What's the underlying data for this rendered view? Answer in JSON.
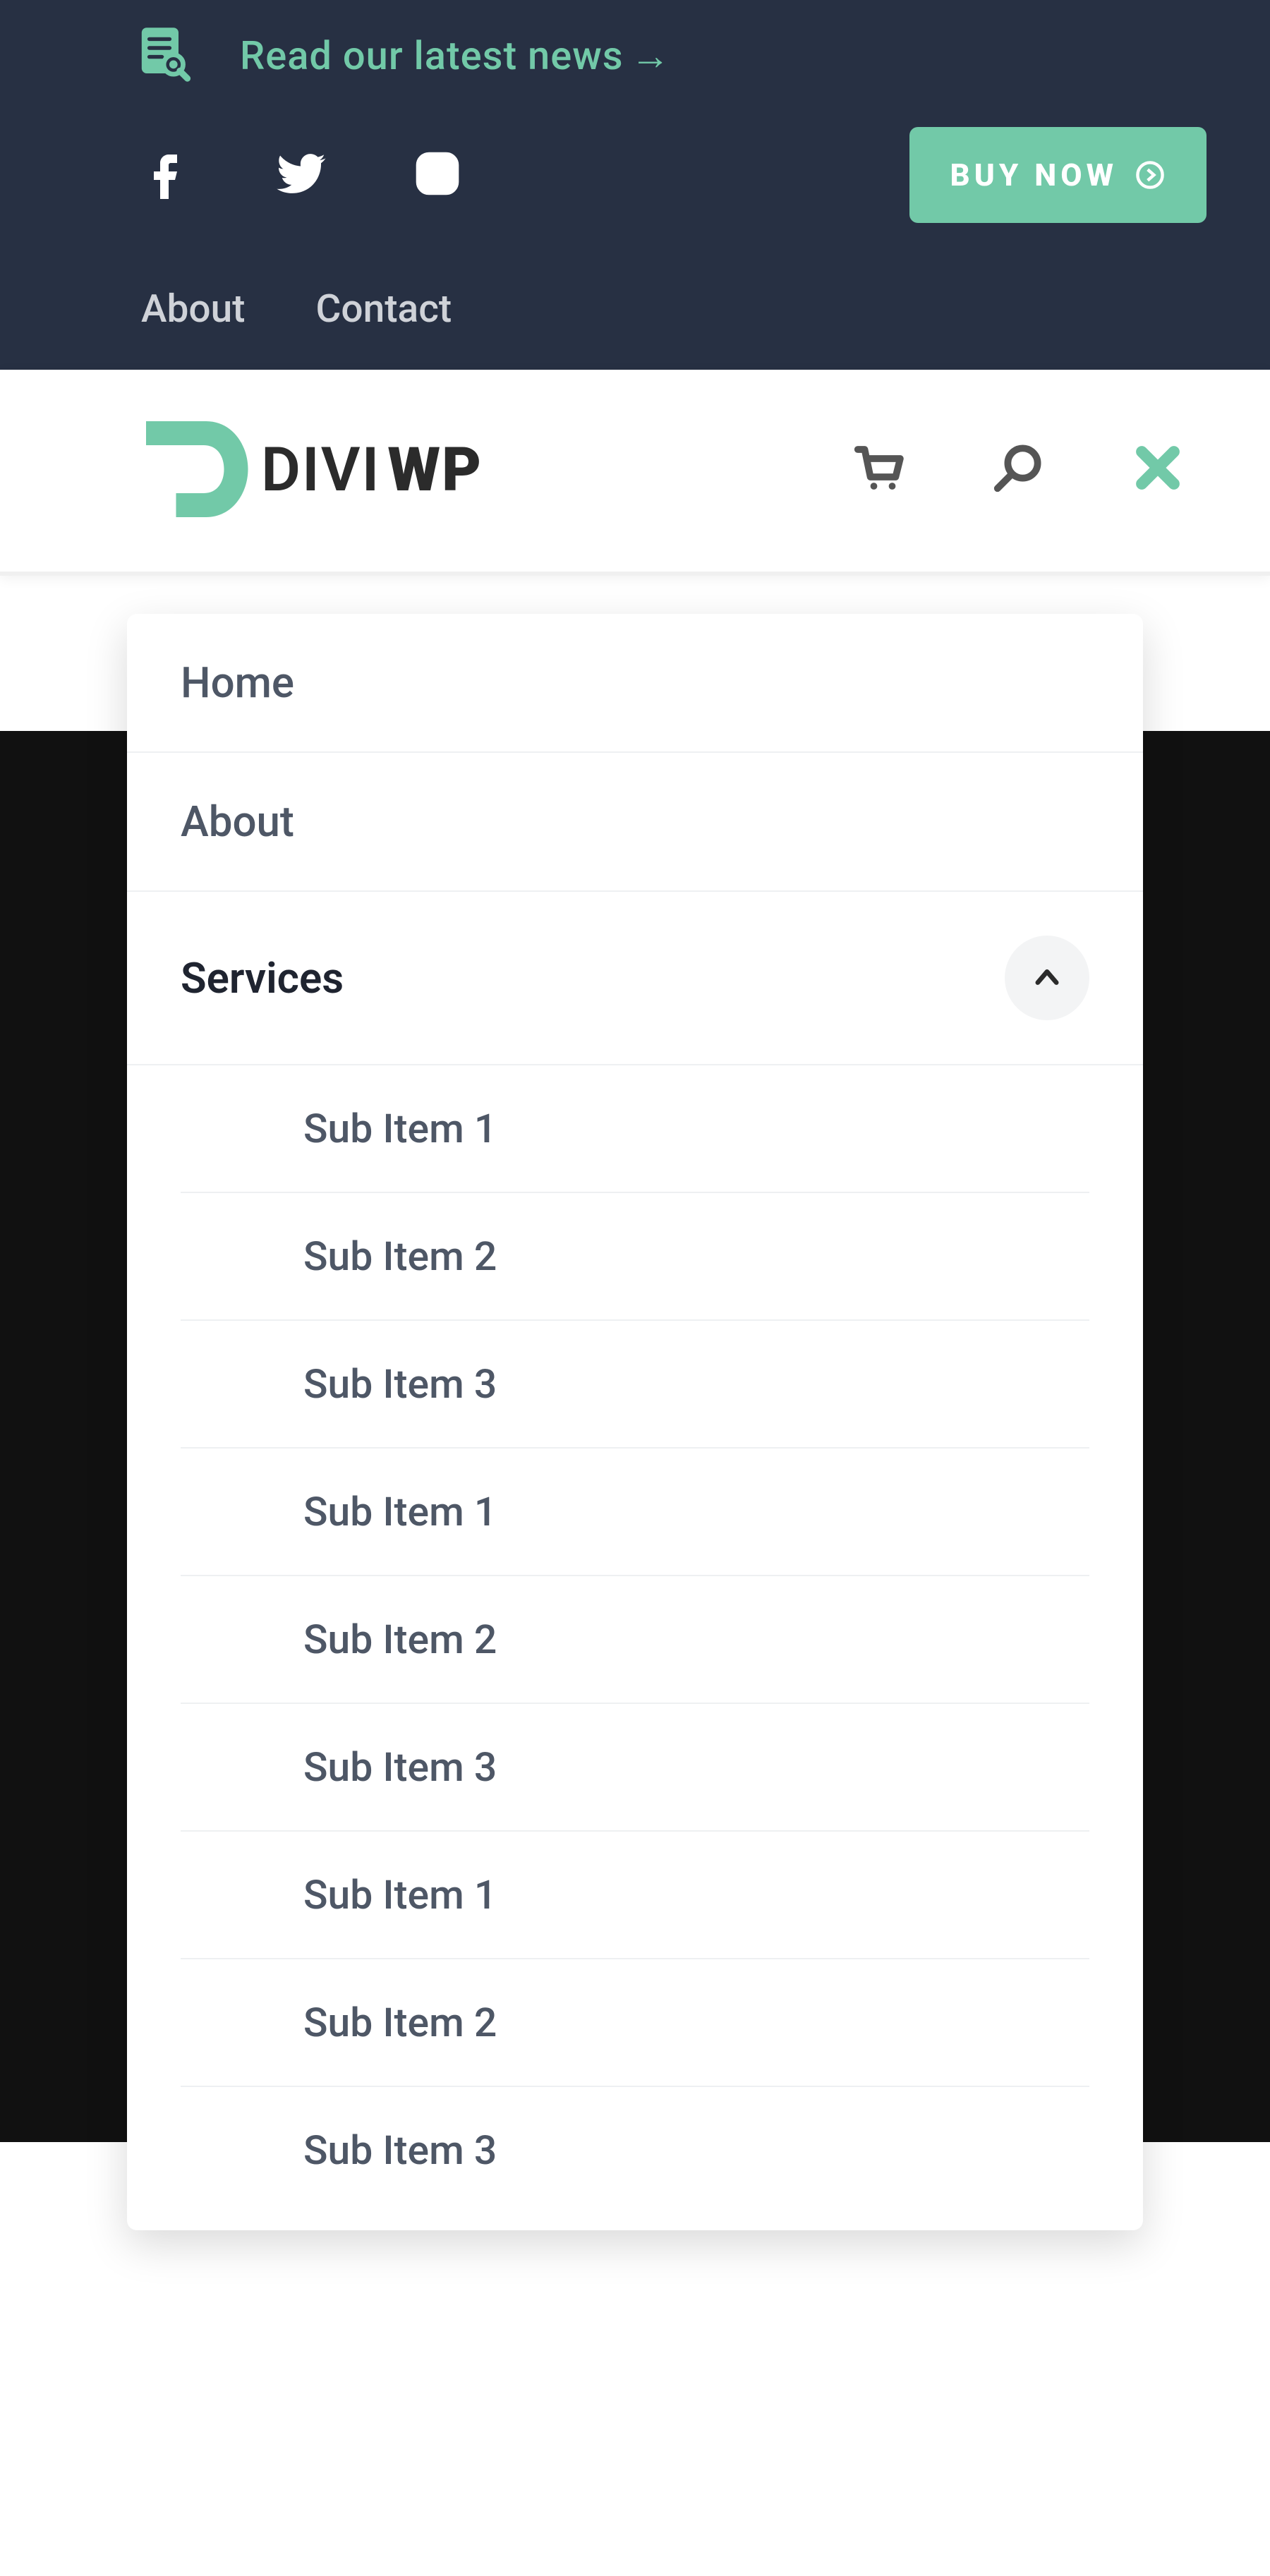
{
  "colors": {
    "accent": "#72c9a8",
    "header_bg": "#273043",
    "text_muted": "#4e5766",
    "text_strong": "#1f2430"
  },
  "top": {
    "news_label": "Read our latest news",
    "news_arrow": "→",
    "socials": [
      "facebook",
      "twitter",
      "instagram"
    ],
    "buy_label": "BUY NOW",
    "util_links": {
      "about": "About",
      "contact": "Contact"
    }
  },
  "header": {
    "logo_text_divi": "DIVI",
    "logo_text_wp": "WP",
    "icons": [
      "cart",
      "search",
      "close"
    ]
  },
  "menu": {
    "items": [
      {
        "label": "Home"
      },
      {
        "label": "About"
      },
      {
        "label": "Services",
        "expanded": true
      }
    ],
    "sub_items": [
      "Sub Item 1",
      "Sub Item 2",
      "Sub Item 3",
      "Sub Item 1",
      "Sub Item 2",
      "Sub Item 3",
      "Sub Item 1",
      "Sub Item 2",
      "Sub Item 3"
    ]
  }
}
